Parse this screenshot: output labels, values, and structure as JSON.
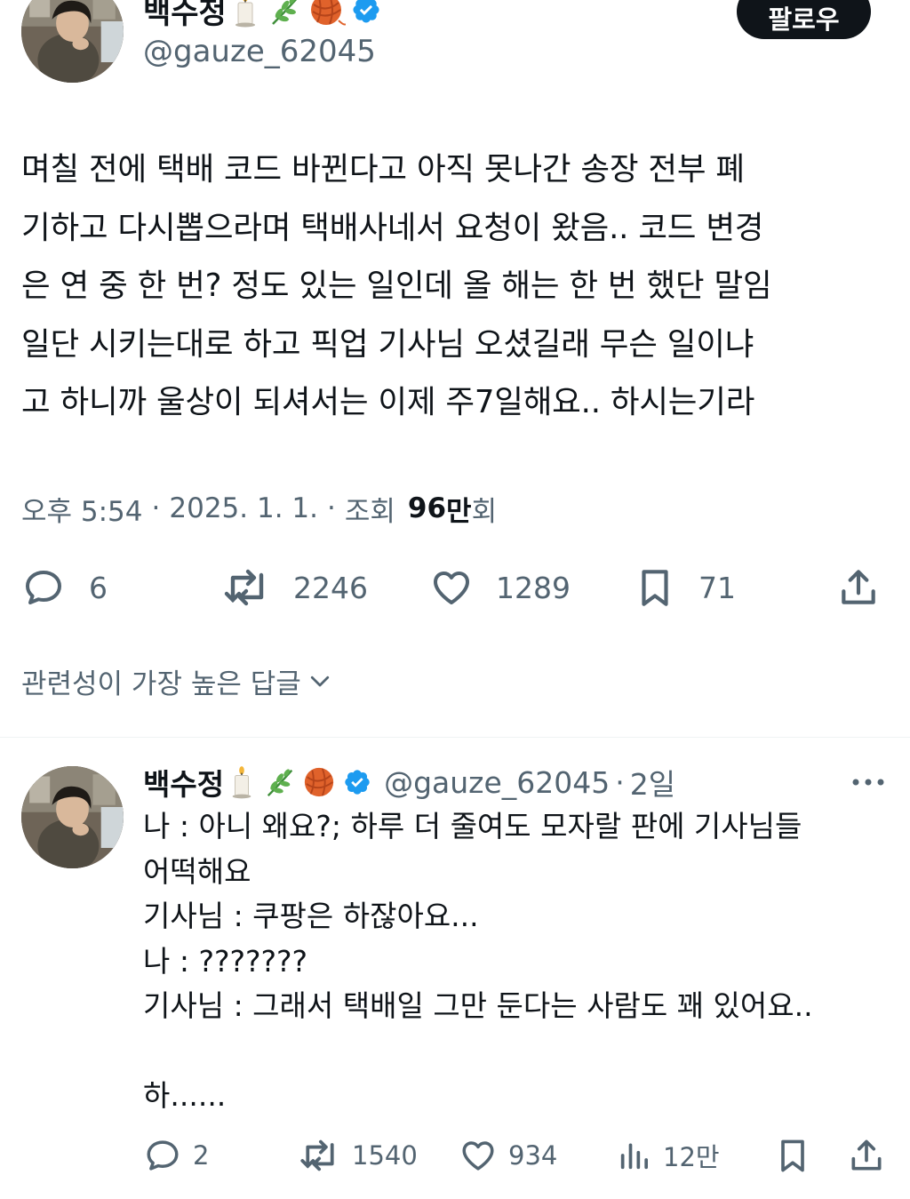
{
  "main_tweet": {
    "author": {
      "display_name": "백수정",
      "emojis": [
        "candle",
        "herb",
        "yarn"
      ],
      "handle": "@gauze_62045",
      "verified": true
    },
    "follow_label": "팔로우",
    "text_lines": [
      "며칠 전에 택배 코드 바뀐다고 아직 못나간 송장 전부 폐",
      "기하고 다시뽑으라며 택배사네서 요청이 왔음.. 코드 변경",
      "은 연 중 한 번? 정도 있는 일인데 올 해는 한 번 했단 말임",
      "일단 시키는대로 하고 픽업 기사님 오셨길래 무슨 일이냐",
      "고 하니까 울상이 되셔서는 이제 주7일해요.. 하시는기라"
    ],
    "meta": {
      "time": "오후 5:54",
      "date": "2025. 1. 1.",
      "views_label": "조회",
      "views_number": "96",
      "views_unit_bold": "만",
      "views_suffix": "회"
    },
    "actions": {
      "replies": "6",
      "reposts": "2246",
      "likes": "1289",
      "bookmarks": "71"
    }
  },
  "sort": {
    "label": "관련성이 가장 높은 답글"
  },
  "reply": {
    "author": {
      "display_name": "백수정",
      "emojis": [
        "candle",
        "herb",
        "yarn"
      ],
      "handle": "@gauze_62045",
      "verified": true
    },
    "separator": "·",
    "time": "2일",
    "text_lines": [
      "나 : 아니 왜요?; 하루 더 줄여도 모자랄 판에 기사님들",
      "어떡해요",
      "기사님 : 쿠팡은 하잖아요...",
      "나 : ???????",
      "기사님 : 그래서 택배일 그만 둔다는 사람도 꽤 있어요..",
      "",
      "하......"
    ],
    "actions": {
      "replies": "2",
      "reposts": "1540",
      "likes": "934",
      "views": "12만"
    }
  },
  "colors": {
    "text_primary": "#0f1419",
    "text_secondary": "#536471",
    "verified_blue": "#1d9bf0",
    "divider": "#eff3f4",
    "follow_bg": "#0f1419"
  }
}
